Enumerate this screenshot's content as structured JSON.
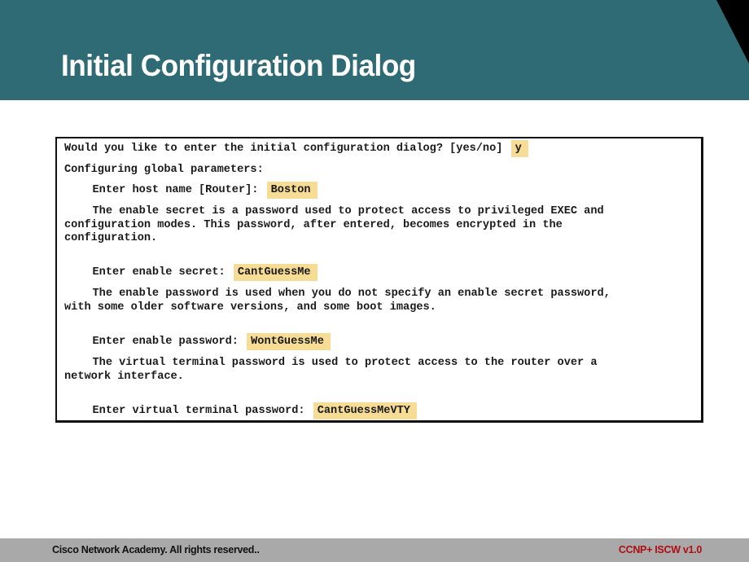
{
  "slide": {
    "title": "Initial Configuration Dialog"
  },
  "dialog": {
    "lines": [
      {
        "prompt": "Would you like to enter the initial configuration dialog? [yes/no]",
        "answer": "y"
      },
      {
        "text": "Configuring global parameters:"
      },
      {
        "prompt": "Enter host name [Router]:",
        "answer": "Boston"
      },
      {
        "text": "The enable secret is a password used to protect access to privileged EXEC and"
      },
      {
        "text": "configuration modes. This password, after entered, becomes encrypted in the"
      },
      {
        "text": "configuration."
      },
      {
        "prompt": "Enter enable secret:",
        "answer": "CantGuessMe"
      },
      {
        "text": "The enable password is used when you do not specify an enable secret password,"
      },
      {
        "text": "with some older software versions, and some boot images."
      },
      {
        "prompt": "Enter enable password:",
        "answer": "WontGuessMe"
      },
      {
        "text": "The virtual terminal password is used to protect access to the router over a"
      },
      {
        "text": "network interface."
      },
      {
        "prompt": "Enter virtual terminal password:",
        "answer": "CantGuessMeVTY"
      }
    ]
  },
  "footer": {
    "copyright": "Cisco Network Academy. All rights reserved..",
    "course": "CCNP+ ISCW v1.0"
  },
  "colors": {
    "header_bg": "#2f6b75",
    "answer_highlight": "#f7dc95",
    "footer_bg": "#a9a9a9",
    "course_text": "#b00d12"
  }
}
